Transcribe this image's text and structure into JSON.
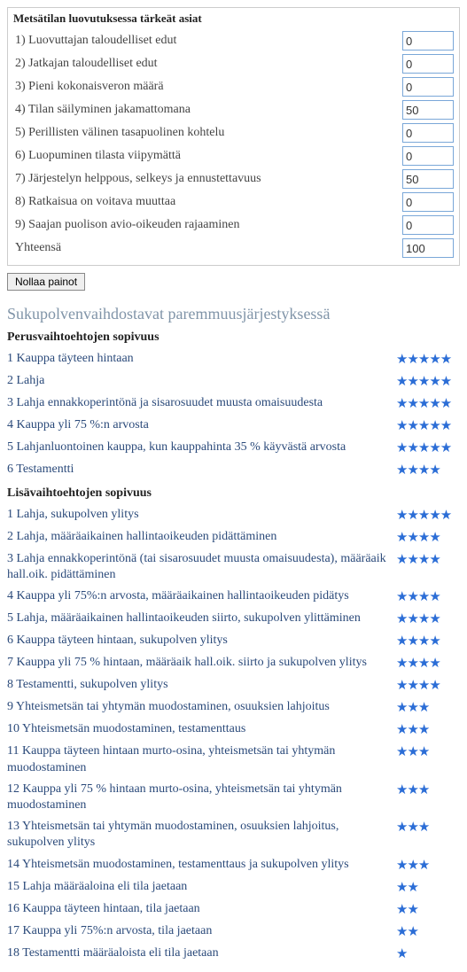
{
  "panel": {
    "title": "Metsätilan luovutuksessa tärkeät asiat",
    "sum_label": "Yhteensä",
    "sum_value": "100",
    "rows": [
      {
        "label": "1) Luovuttajan taloudelliset edut",
        "value": "0"
      },
      {
        "label": "2) Jatkajan taloudelliset edut",
        "value": "0"
      },
      {
        "label": "3) Pieni kokonaisveron määrä",
        "value": "0"
      },
      {
        "label": "4) Tilan säilyminen jakamattomana",
        "value": "50"
      },
      {
        "label": "5) Perillisten välinen tasapuolinen kohtelu",
        "value": "0"
      },
      {
        "label": "6) Luopuminen tilasta viipymättä",
        "value": "0"
      },
      {
        "label": "7) Järjestelyn helppous, selkeys ja ennustettavuus",
        "value": "50"
      },
      {
        "label": "8) Ratkaisua on voitava muuttaa",
        "value": "0"
      },
      {
        "label": "9) Saajan puolison avio-oikeuden rajaaminen",
        "value": "0"
      }
    ]
  },
  "reset_button": "Nollaa painot",
  "ranking_heading": "Sukupolvenvaihdostavat paremmuusjärjestyksessä",
  "groups": [
    {
      "title": "Perusvaihtoehtojen sopivuus",
      "items": [
        {
          "label": "1 Kauppa täyteen hintaan",
          "stars": 5
        },
        {
          "label": "2 Lahja",
          "stars": 5
        },
        {
          "label": "3 Lahja ennakkoperintönä ja sisarosuudet muusta omaisuudesta",
          "stars": 5
        },
        {
          "label": "4 Kauppa yli 75 %:n arvosta",
          "stars": 5
        },
        {
          "label": "5 Lahjanluontoinen kauppa, kun kauppahinta 35 % käyvästä arvosta",
          "stars": 5
        },
        {
          "label": "6 Testamentti",
          "stars": 4
        }
      ]
    },
    {
      "title": "Lisävaihtoehtojen sopivuus",
      "items": [
        {
          "label": "1 Lahja, sukupolven ylitys",
          "stars": 5
        },
        {
          "label": "2 Lahja, määräaikainen hallintaoikeuden pidättäminen",
          "stars": 4
        },
        {
          "label": "3 Lahja ennakkoperintönä (tai sisarosuudet muusta omaisuudesta), määräaik hall.oik. pidättäminen",
          "stars": 4
        },
        {
          "label": "4 Kauppa yli 75%:n arvosta, määräaikainen hallintaoikeuden pidätys",
          "stars": 4
        },
        {
          "label": "5 Lahja, määräaikainen hallintaoikeuden siirto, sukupolven ylittäminen",
          "stars": 4
        },
        {
          "label": "6 Kauppa täyteen hintaan, sukupolven ylitys",
          "stars": 4
        },
        {
          "label": "7 Kauppa yli 75 % hintaan, määräaik hall.oik. siirto ja sukupolven ylitys",
          "stars": 4
        },
        {
          "label": "8 Testamentti, sukupolven ylitys",
          "stars": 4
        },
        {
          "label": "9 Yhteismetsän tai yhtymän muodostaminen, osuuksien lahjoitus",
          "stars": 3
        },
        {
          "label": "10 Yhteismetsän muodostaminen, testamenttaus",
          "stars": 3
        },
        {
          "label": "11 Kauppa täyteen hintaan murto-osina, yhteismetsän tai yhtymän muodostaminen",
          "stars": 3
        },
        {
          "label": "12 Kauppa yli 75 % hintaan murto-osina, yhteismetsän tai yhtymän muodostaminen",
          "stars": 3
        },
        {
          "label": "13 Yhteismetsän tai yhtymän muodostaminen, osuuksien lahjoitus, sukupolven ylitys",
          "stars": 3
        },
        {
          "label": "14 Yhteismetsän muodostaminen, testamenttaus ja sukupolven ylitys",
          "stars": 3
        },
        {
          "label": "15 Lahja määräaloina eli tila jaetaan",
          "stars": 2
        },
        {
          "label": "16 Kauppa täyteen hintaan, tila jaetaan",
          "stars": 2
        },
        {
          "label": "17 Kauppa yli 75%:n arvosta, tila jaetaan",
          "stars": 2
        },
        {
          "label": "18 Testamentti määräaloista eli tila jaetaan",
          "stars": 1
        }
      ]
    }
  ]
}
